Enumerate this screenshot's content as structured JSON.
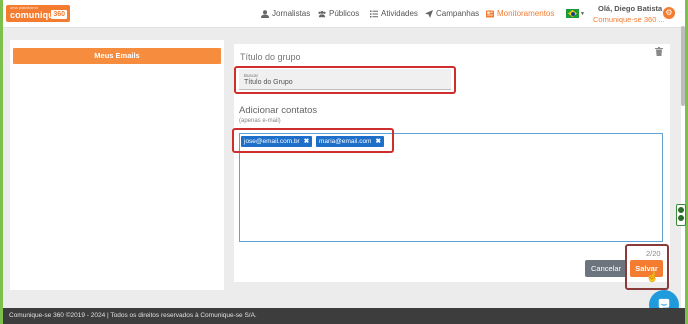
{
  "logo": {
    "small": "uma plataforma",
    "brand": "comunique",
    "version": "360"
  },
  "nav": {
    "items": [
      {
        "label": "Jornalistas",
        "icon": "user-icon"
      },
      {
        "label": "Públicos",
        "icon": "users-icon"
      },
      {
        "label": "Atividades",
        "icon": "list-icon"
      },
      {
        "label": "Campanhas",
        "icon": "paper-plane-icon"
      },
      {
        "label": "Monitoramentos",
        "icon": "newspaper-icon"
      }
    ],
    "active": "Monitoramentos"
  },
  "user": {
    "greeting": "Olá, Diego Batista",
    "org": "Comunique-se 360 ..."
  },
  "sidebar": {
    "meus_emails": "Meus Emails"
  },
  "form": {
    "group_title": "Título do grupo",
    "field_label": "Buscar",
    "field_value": "Título do Grupo",
    "contacts_title": "Adicionar contatos",
    "contacts_subtitle": "(apenas e-mail)",
    "tags": [
      "jose@email.com.br",
      "maria@email.com"
    ],
    "tag_remove": "✖",
    "counter": "2/20",
    "cancel_label": "Cancelar",
    "save_label": "Salvar"
  },
  "footer": {
    "text": "Comunique-se 360 ©2019 - 2024 | Todos os direitos reservados à Comunique-se S/A."
  },
  "colors": {
    "brand_orange": "#f47c30",
    "tag_blue": "#1d6fc9",
    "highlight_red": "#cf2e2e"
  }
}
